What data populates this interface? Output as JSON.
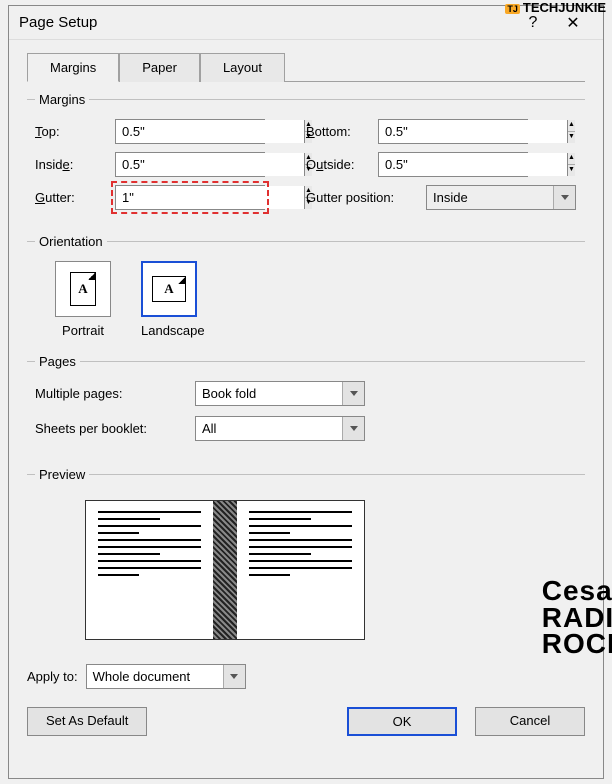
{
  "watermarks": {
    "top": "TECHJUNKIE",
    "cesar_l1": "Cesar",
    "cesar_l2": "RADIO",
    "cesar_l3": "ROCK"
  },
  "titlebar": {
    "title": "Page Setup",
    "help": "?",
    "close": "✕"
  },
  "tabs": {
    "margins": "Margins",
    "paper": "Paper",
    "layout": "Layout"
  },
  "sections": {
    "margins": "Margins",
    "orientation": "Orientation",
    "pages": "Pages",
    "preview": "Preview"
  },
  "margins": {
    "top_label": "Top:",
    "top_value": "0.5\"",
    "bottom_label": "Bottom:",
    "bottom_value": "0.5\"",
    "inside_label": "Inside:",
    "inside_value": "0.5\"",
    "outside_label": "Outside:",
    "outside_value": "0.5\"",
    "gutter_label": "Gutter:",
    "gutter_value": "1\"",
    "gutterpos_label": "Gutter position:",
    "gutterpos_value": "Inside"
  },
  "orientation": {
    "portrait": "Portrait",
    "landscape": "Landscape",
    "letter": "A"
  },
  "pages": {
    "multiple_label": "Multiple pages:",
    "multiple_value": "Book fold",
    "sheets_label": "Sheets per booklet:",
    "sheets_value": "All"
  },
  "applyto": {
    "label": "Apply to:",
    "value": "Whole document"
  },
  "buttons": {
    "default": "Set As Default",
    "ok": "OK",
    "cancel": "Cancel"
  }
}
